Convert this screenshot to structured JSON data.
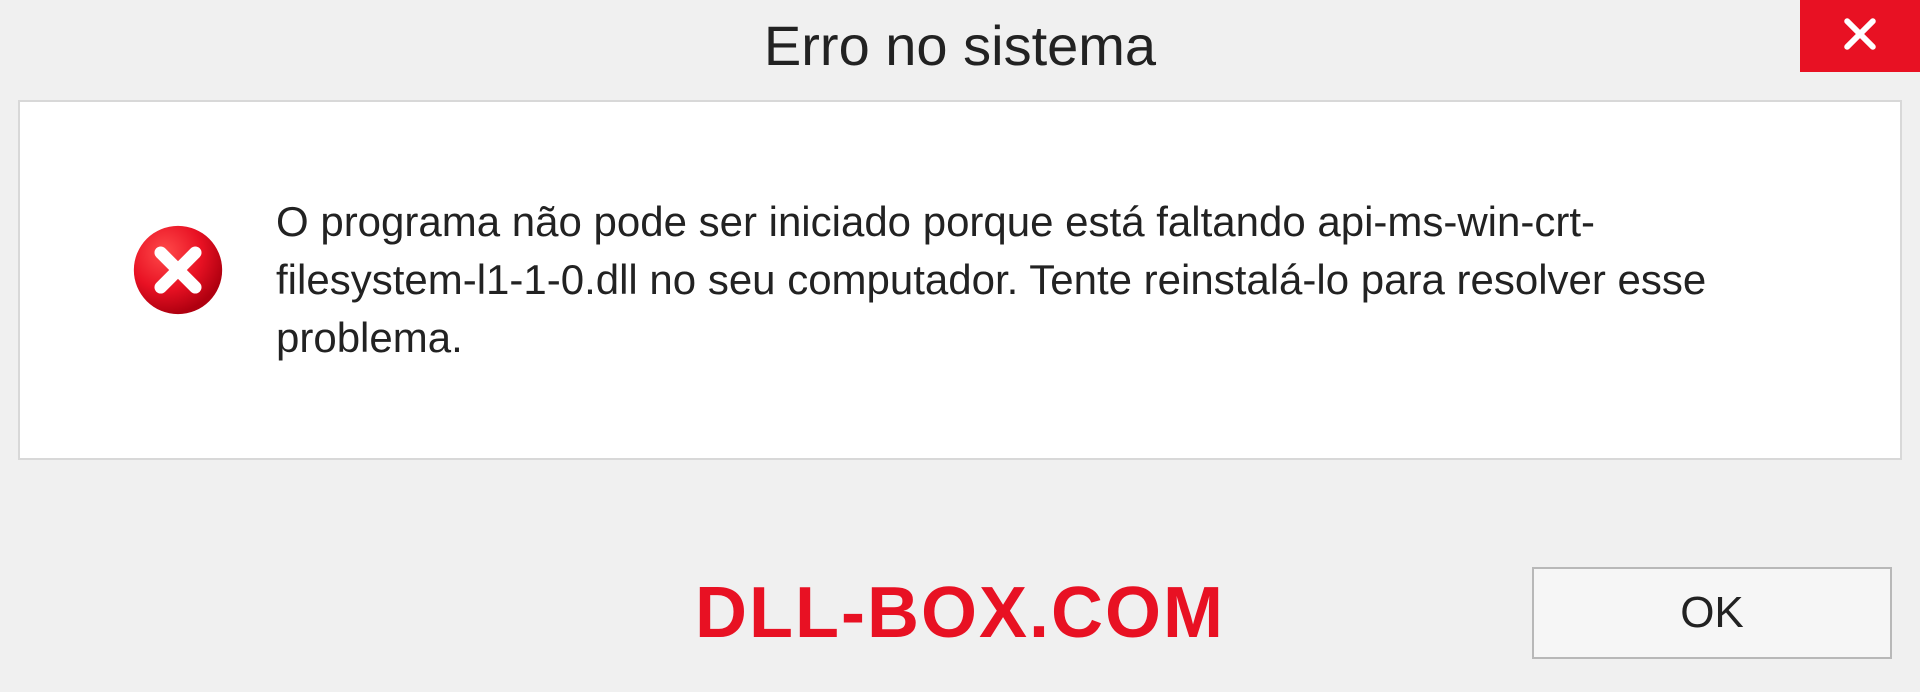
{
  "dialog": {
    "title": "Erro no sistema",
    "message": "O programa não pode ser iniciado porque está faltando api-ms-win-crt-filesystem-l1-1-0.dll no seu computador. Tente reinstalá-lo para resolver esse problema.",
    "ok_label": "OK"
  },
  "watermark": {
    "text": "DLL-BOX.COM"
  },
  "colors": {
    "error_red": "#e81123",
    "bg": "#f0f0f0"
  }
}
